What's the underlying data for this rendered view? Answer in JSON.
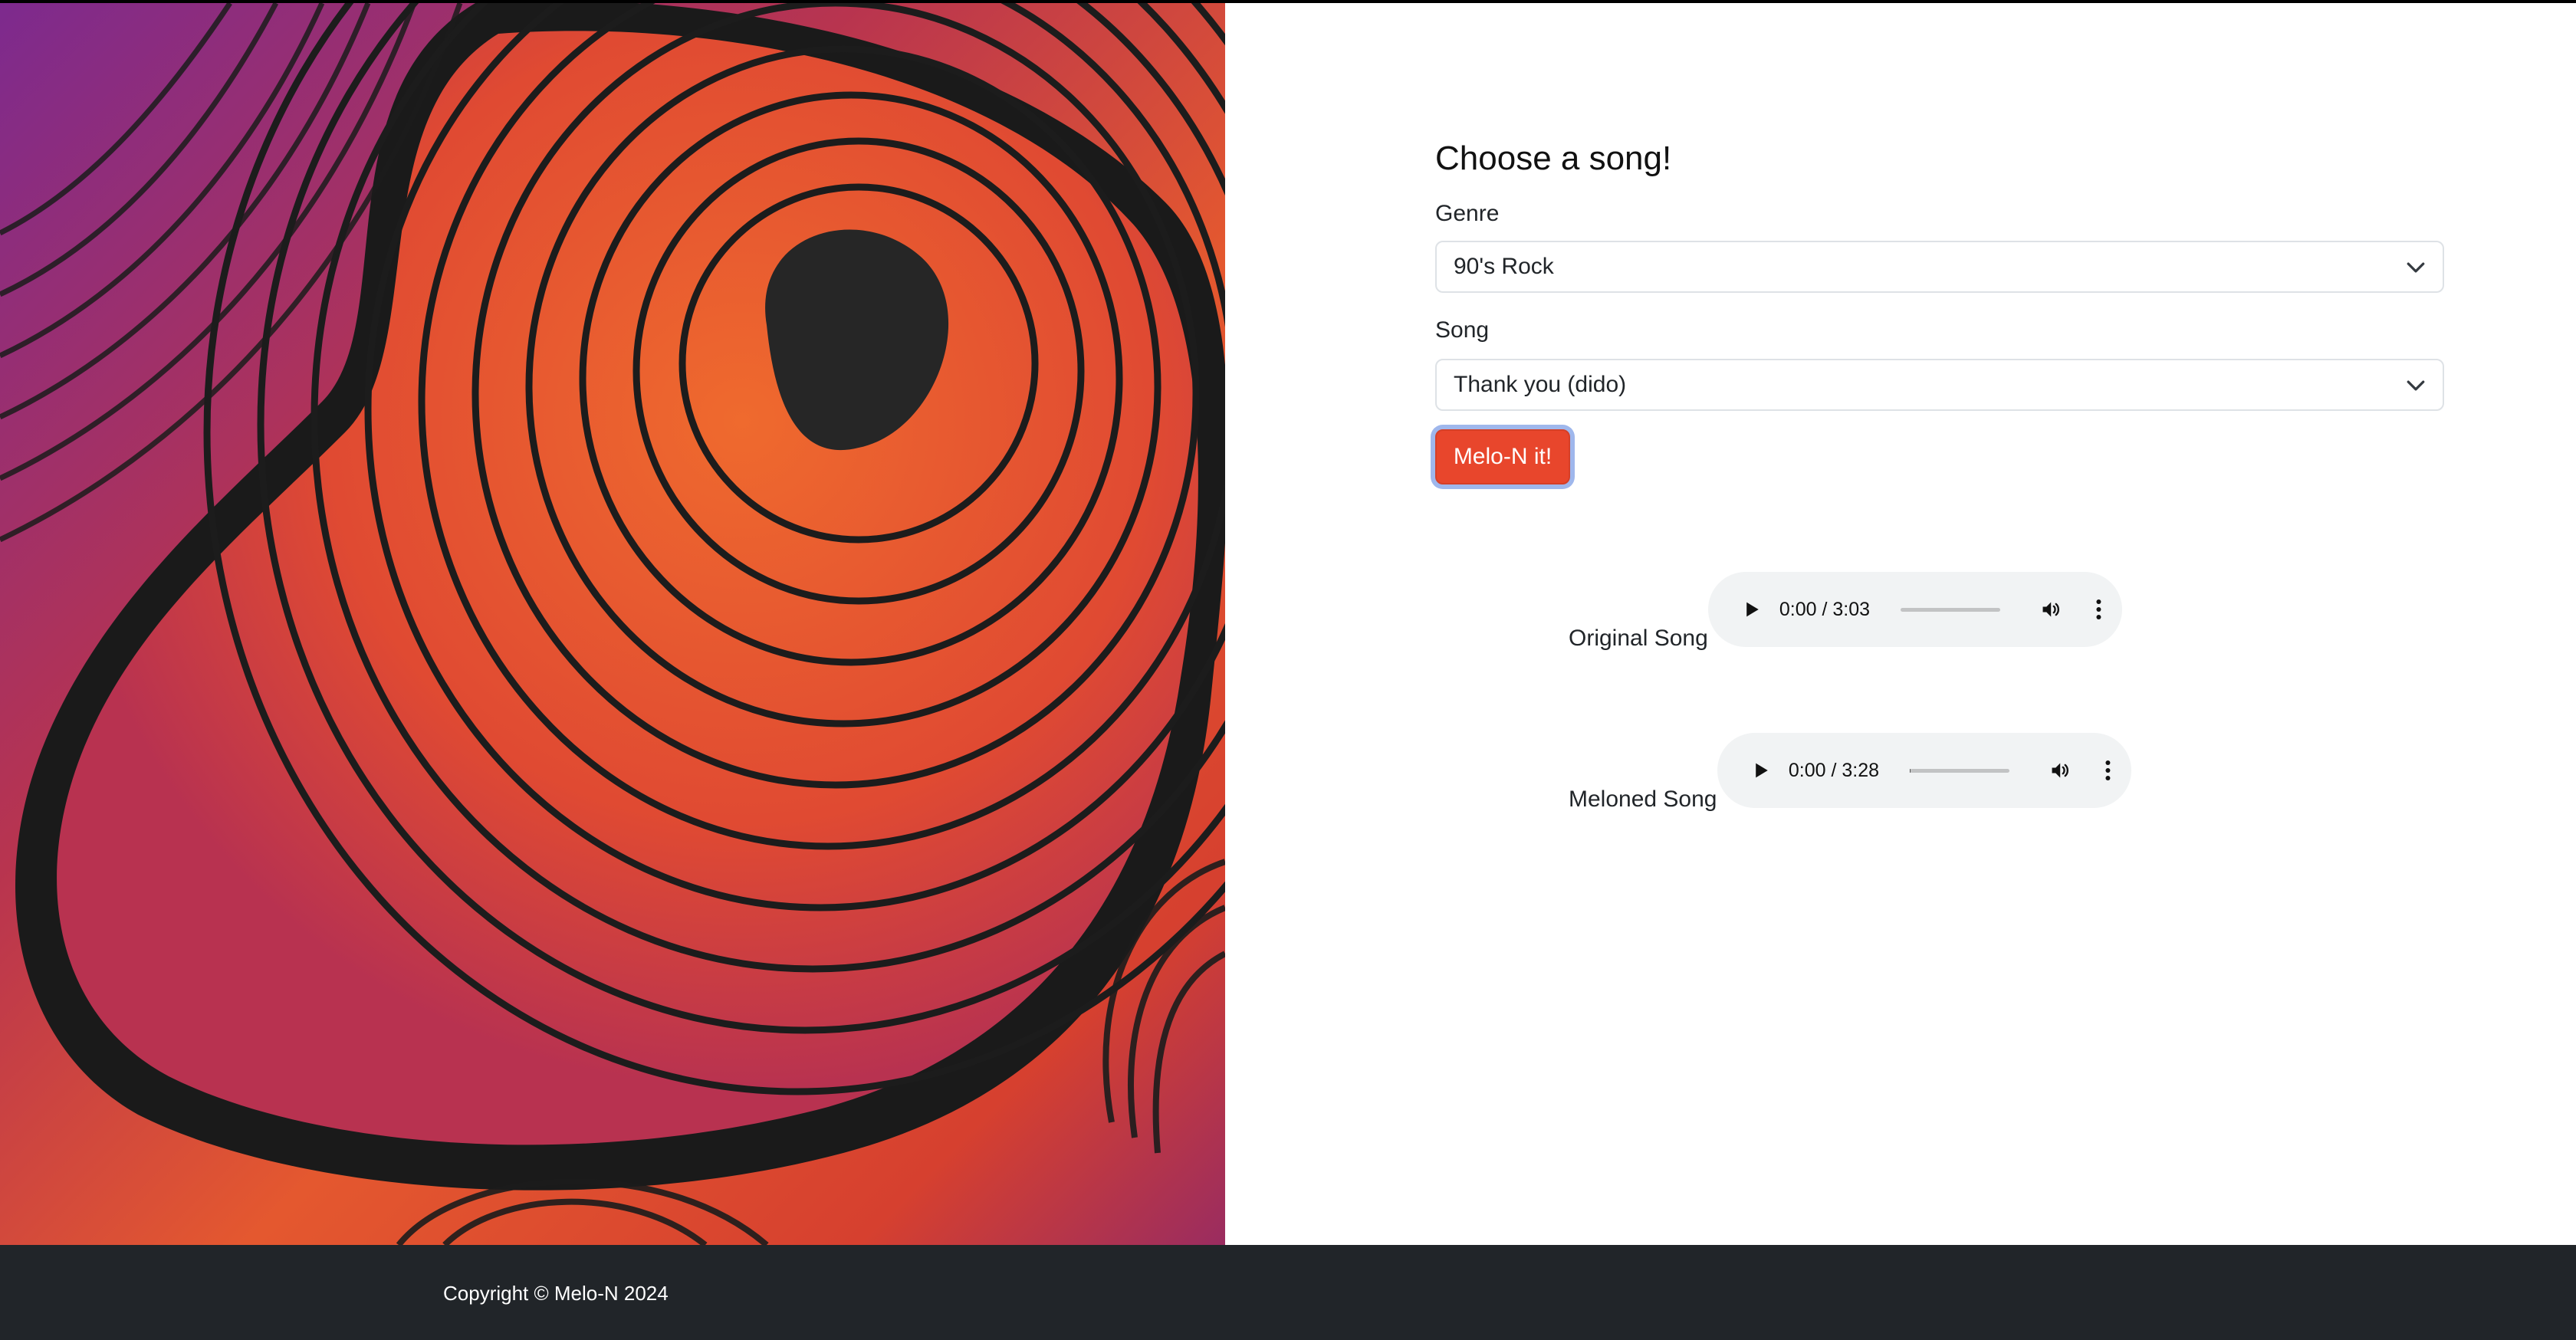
{
  "form": {
    "heading": "Choose a song!",
    "genre_label": "Genre",
    "genre_value": "90's Rock",
    "song_label": "Song",
    "song_value": "Thank you (dido)",
    "submit_label": "Melo-N it!"
  },
  "players": {
    "original": {
      "label": "Original Song",
      "time": "0:00 / 3:03",
      "progress": 0
    },
    "meloned": {
      "label": "Meloned Song",
      "time": "0:00 / 3:28",
      "progress": 0.01
    }
  },
  "footer": {
    "copyright": "Copyright © Melo-N 2024"
  },
  "icons": {
    "select_arrow": "chevron-down-icon",
    "play": "play-icon",
    "volume": "volume-icon",
    "more": "more-vertical-icon"
  },
  "colors": {
    "accent": "#e8462c",
    "focus_ring": "#9fb7ec",
    "footer_bg": "#212529",
    "player_bg": "#f1f3f4"
  }
}
